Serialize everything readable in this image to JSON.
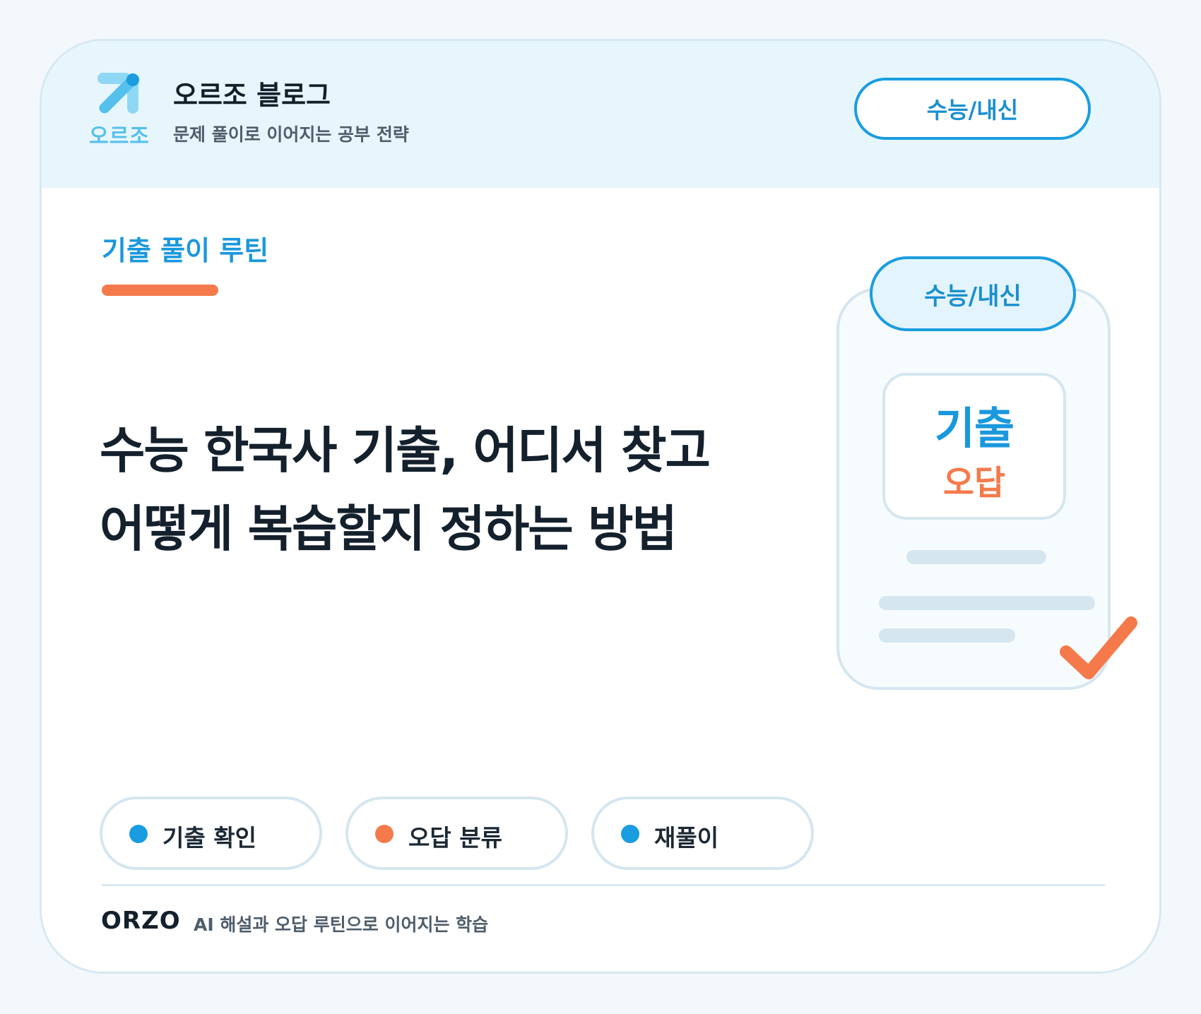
{
  "header": {
    "logo_text": "오르조",
    "title": "오르조 블로그",
    "subtitle": "문제 풀이로 이어지는 공부 전략",
    "pill_label": "수능/내신"
  },
  "main": {
    "category": "기출 풀이 루틴",
    "headline_lines": [
      "수능 한국사 기출, 어디서 찾고",
      "어떻게 복습할지 정하는 방법"
    ]
  },
  "illustration": {
    "pill_label": "수능/내신",
    "box_main": "기출",
    "box_sub": "오답",
    "check_icon": "checkmark-icon"
  },
  "chips": [
    {
      "label": "기출 확인",
      "dot_color": "#1a9de0"
    },
    {
      "label": "오답 분류",
      "dot_color": "#f57a4b"
    },
    {
      "label": "재풀이",
      "dot_color": "#1a9de0"
    }
  ],
  "footer": {
    "brand": "ORZO",
    "text": "AI 해설과 오답 루틴으로 이어지는 학습"
  },
  "colors": {
    "accent_blue": "#1a9de0",
    "accent_orange": "#f57a4b",
    "header_bg": "#e7f6fd",
    "text_dark": "#14202c"
  }
}
